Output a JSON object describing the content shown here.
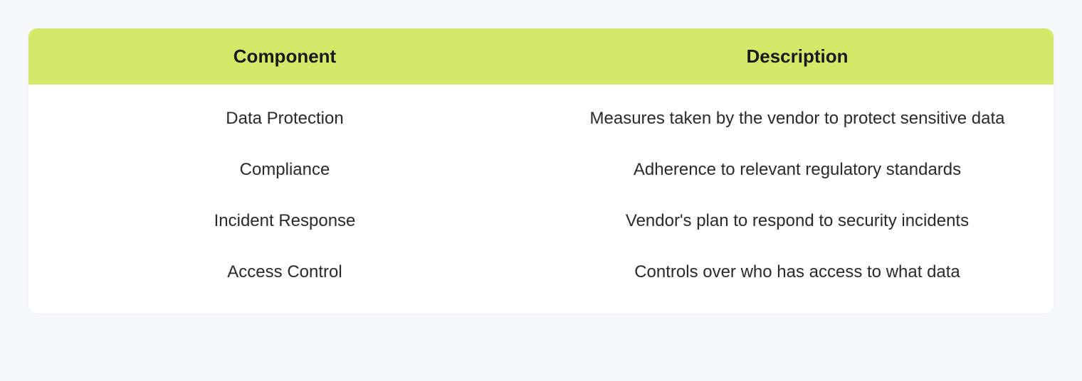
{
  "table": {
    "headers": [
      "Component",
      "Description"
    ],
    "rows": [
      {
        "component": "Data Protection",
        "description": "Measures taken by the vendor to protect sensitive data"
      },
      {
        "component": "Compliance",
        "description": "Adherence to relevant regulatory standards"
      },
      {
        "component": "Incident Response",
        "description": "Vendor's plan to respond to security incidents"
      },
      {
        "component": "Access Control",
        "description": "Controls over who has access to what data"
      }
    ]
  }
}
